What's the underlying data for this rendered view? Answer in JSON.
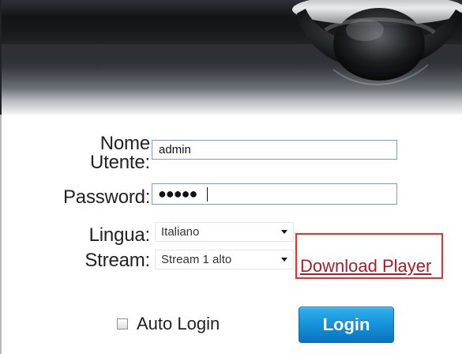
{
  "header": {
    "camera_image_name": "security-camera-image"
  },
  "login_form": {
    "username": {
      "label_line1": "Nome",
      "label_line2": "Utente:",
      "value": "admin"
    },
    "password": {
      "label": "Password:",
      "masked_value": "●●●●●"
    },
    "language": {
      "label": "Lingua:",
      "selected": "Italiano"
    },
    "stream": {
      "label": "Stream:",
      "selected": "Stream 1 alto"
    },
    "download_player": "Download Player",
    "auto_login": {
      "label": "Auto Login",
      "checked": false
    },
    "login_button": "Login"
  },
  "colors": {
    "link": "#a61d2b",
    "highlight_border": "#ef2c2c",
    "login_button": "#1793d9",
    "input_border": "#7a9cd3"
  }
}
